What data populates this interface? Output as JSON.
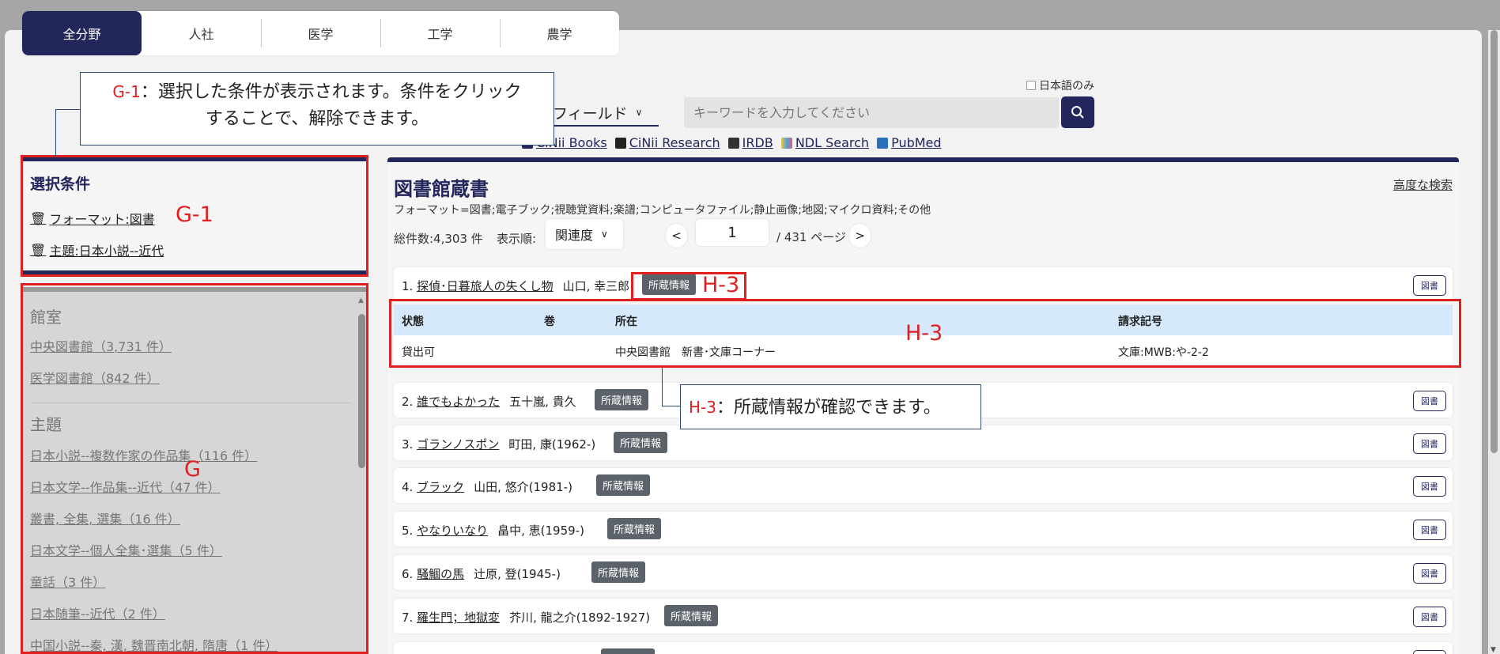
{
  "tabs": [
    "全分野",
    "人社",
    "医学",
    "工学",
    "農学"
  ],
  "search": {
    "field_select": "全フィールド",
    "japanese_only": "日本語のみ",
    "placeholder": "キーワードを入力してください"
  },
  "external_links": [
    "CiNii Books",
    "CiNii Research",
    "IRDB",
    "NDL Search",
    "PubMed"
  ],
  "callouts": {
    "g1_tag": "G-1",
    "g1_line1": "：選択した条件が表示されます。条件をクリック",
    "g1_line2": "することで、解除できます。",
    "h3_tag": "H-3",
    "h3_text": "：所蔵情報が確認できます。"
  },
  "labels": {
    "g1": "G-1",
    "g": "G",
    "h3_button": "H-3",
    "h3_table": "H-3"
  },
  "selected": {
    "title": "選択条件",
    "chips": [
      "フォーマット:図書",
      "主題:日本小説--近代"
    ]
  },
  "facets": {
    "room_title": "館室",
    "rooms": [
      "中央図書館（3,731 件）",
      "医学図書館（842 件）"
    ],
    "subject_title": "主題",
    "subjects": [
      "日本小説--複数作家の作品集（116 件）",
      "日本文学--作品集--近代（47 件）",
      "叢書, 全集, 選集（16 件）",
      "日本文学--個人全集･選集（5 件）",
      "童話（3 件）",
      "日本随筆--近代（2 件）",
      "中国小説--秦, 漢, 魏晋南北朝, 隋唐（1 件）"
    ]
  },
  "results": {
    "title": "図書館蔵書",
    "advanced": "高度な検索",
    "filter": "フォーマット=図書;電子ブック;視聴覚資料;楽譜;コンピュータファイル;静止画像;地図;マイクロ資料;その他",
    "total": "総件数:4,303 件",
    "sort_label": "表示順:",
    "sort_value": "関連度",
    "prev": "<",
    "next": ">",
    "page": "1",
    "page_total": "/ 431 ページ",
    "holdings_label": "所蔵情報",
    "book_label": "図書",
    "items": [
      {
        "num": "1.",
        "title": "探偵･日暮旅人の失くし物",
        "author": "山口, 幸三郎"
      },
      {
        "num": "2.",
        "title": "誰でもよかった",
        "author": "五十嵐, 貴久"
      },
      {
        "num": "3.",
        "title": "ゴランノスポン",
        "author": "町田, 康(1962-)"
      },
      {
        "num": "4.",
        "title": "ブラック",
        "author": "山田, 悠介(1981-)"
      },
      {
        "num": "5.",
        "title": "やなりいなり",
        "author": "畠中, 恵(1959-)"
      },
      {
        "num": "6.",
        "title": "騒鯝の馬",
        "author": "辻原, 登(1945-)"
      },
      {
        "num": "7.",
        "title": "羅生門；地獄変",
        "author": "芥川, 龍之介(1892-1927)"
      }
    ],
    "holdings_table": {
      "headers": [
        "状態",
        "巻",
        "所在",
        "請求記号"
      ],
      "row": [
        "貸出可",
        "",
        "中央図書館　新書･文庫コーナー",
        "文庫:MWB:や-2-2"
      ]
    }
  }
}
